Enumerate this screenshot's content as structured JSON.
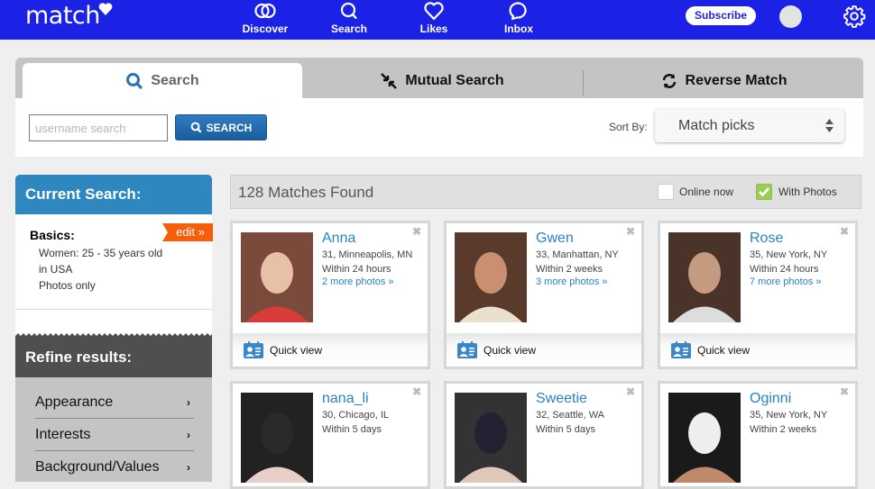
{
  "header": {
    "logo": "match",
    "nav": [
      {
        "label": "Discover",
        "icon": "rings-icon"
      },
      {
        "label": "Search",
        "icon": "search-icon"
      },
      {
        "label": "Likes",
        "icon": "heart-icon"
      },
      {
        "label": "Inbox",
        "icon": "chat-bubble-icon"
      }
    ],
    "subscribe_label": "Subscribe",
    "brand_color": "#1b22e6"
  },
  "tabs": [
    {
      "label": "Search",
      "active": true
    },
    {
      "label": "Mutual Search",
      "active": false
    },
    {
      "label": "Reverse Match",
      "active": false
    }
  ],
  "search": {
    "username_placeholder": "username search",
    "username_value": "",
    "button_label": "SEARCH",
    "sort_label": "Sort By:",
    "sort_value": "Match picks"
  },
  "sidebar": {
    "current_search_title": "Current Search:",
    "basics_label": "Basics:",
    "edit_label": "edit »",
    "basics_lines": [
      "Women: 25 - 35 years old",
      "in USA",
      "Photos only"
    ],
    "refine_title": "Refine results:",
    "refine_items": [
      "Appearance",
      "Interests",
      "Background/Values"
    ]
  },
  "results": {
    "count_text": "128 Matches Found",
    "filters": [
      {
        "label": "Online now",
        "checked": false
      },
      {
        "label": "With Photos",
        "checked": true
      }
    ],
    "quick_view_label": "Quick view",
    "profiles": [
      {
        "name": "Anna",
        "details": "31, Minneapolis, MN",
        "active": "Within 24 hours",
        "more_photos": "2 more photos »"
      },
      {
        "name": "Gwen",
        "details": "33, Manhattan, NY",
        "active": "Within 2 weeks",
        "more_photos": "3 more photos »"
      },
      {
        "name": "Rose",
        "details": "35, New York, NY",
        "active": "Within 24 hours",
        "more_photos": "7 more photos »"
      },
      {
        "name": "nana_li",
        "details": "30, Chicago, IL",
        "active": "Within 5 days",
        "more_photos": ""
      },
      {
        "name": "Sweetie",
        "details": "32, Seattle, WA",
        "active": "Within 5 days",
        "more_photos": ""
      },
      {
        "name": "Oginni",
        "details": "35, New York, NY",
        "active": "Within 2 weeks",
        "more_photos": ""
      }
    ]
  }
}
